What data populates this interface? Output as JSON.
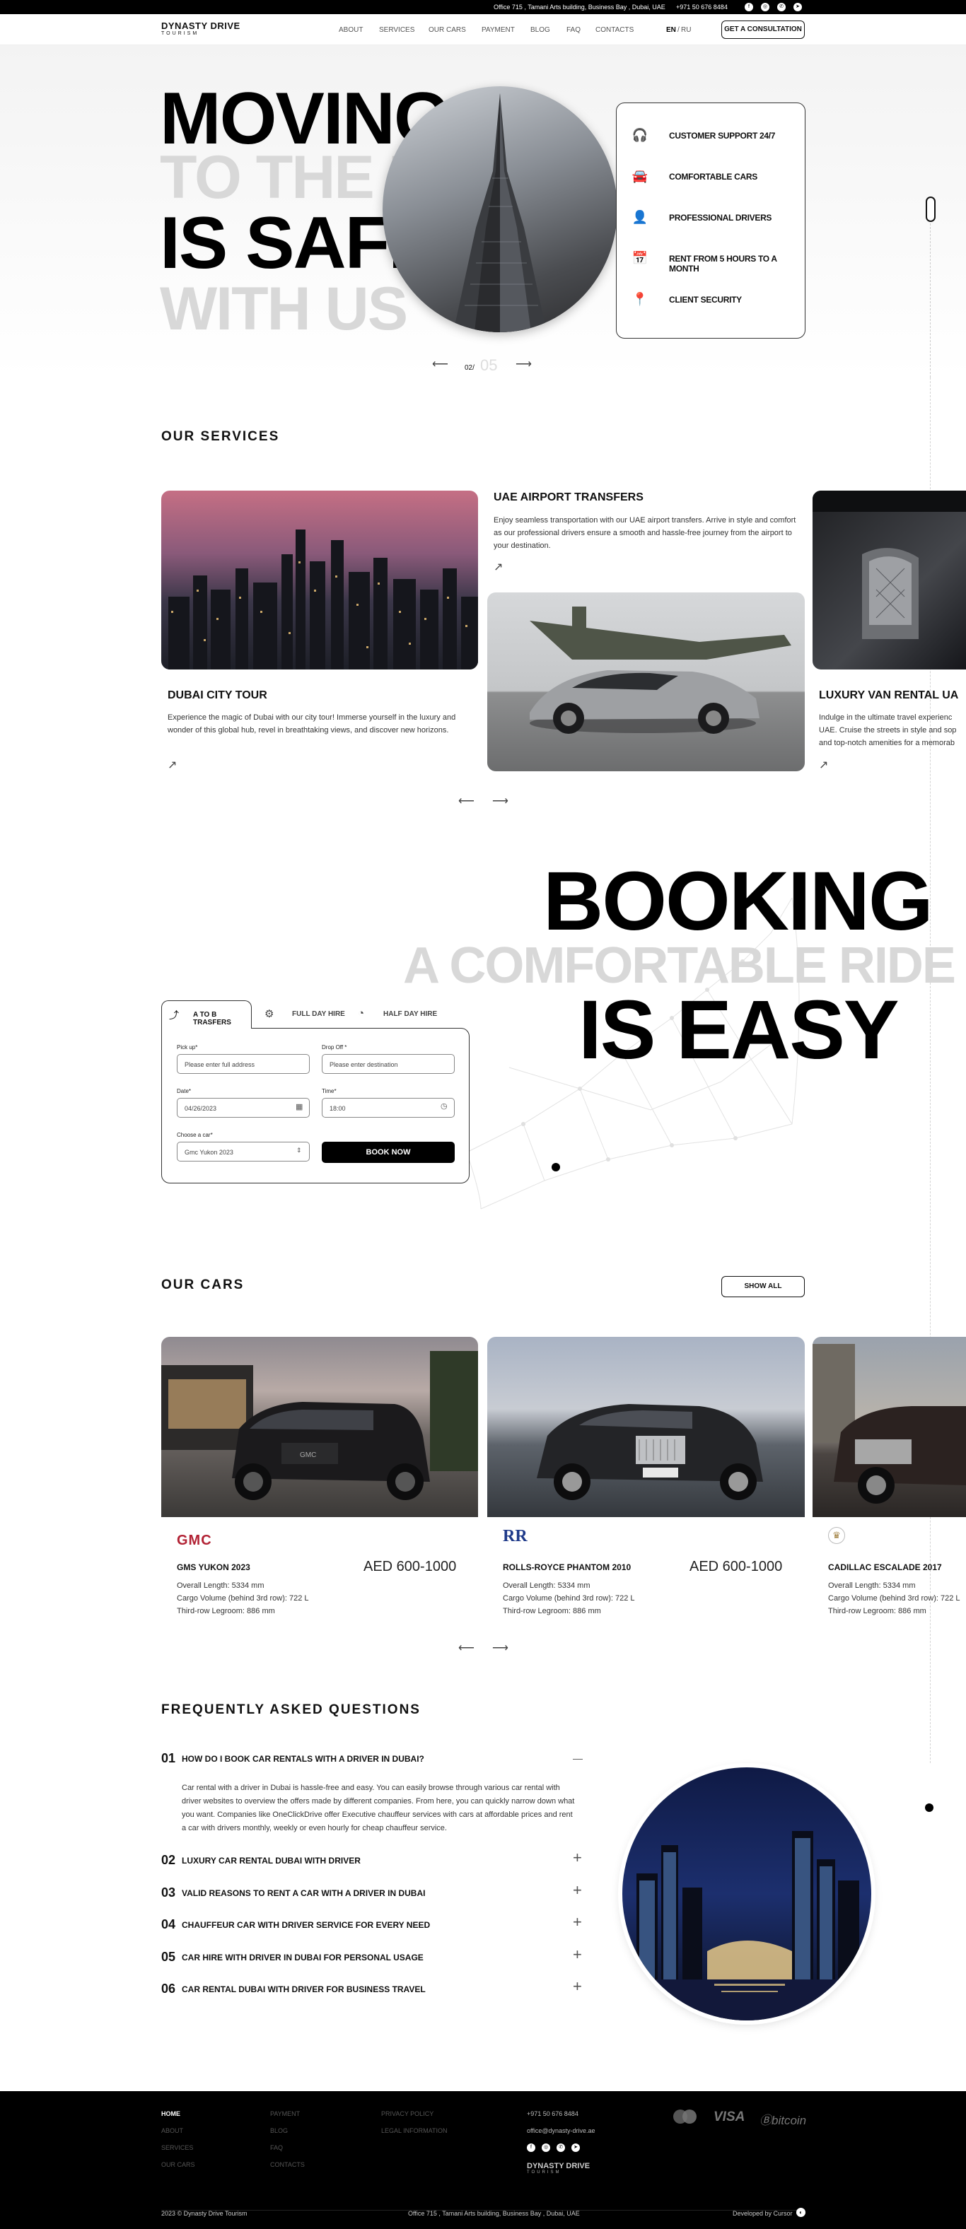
{
  "topbar": {
    "address": "Office 715 , Tamani Arts building, Business Bay , Dubai, UAE",
    "phone": "+971 50 676 8484",
    "social_icons": [
      "facebook-icon",
      "instagram-icon",
      "whatsapp-icon",
      "telegram-icon"
    ]
  },
  "nav": {
    "logo_title": "DYNASTY DRIVE",
    "logo_sub": "TOURISM",
    "links": [
      "ABOUT",
      "SERVICES",
      "OUR CARS",
      "PAYMENT",
      "BLOG",
      "FAQ",
      "CONTACTS"
    ],
    "lang_en": "EN",
    "lang_sep": "/",
    "lang_ru": "RU",
    "cta": "GET A CONSULTATION"
  },
  "hero": {
    "line1": "MOVING",
    "line2": "TO THE UAE",
    "line3": "IS SAFE",
    "line4": "WITH US",
    "features": [
      "CUSTOMER SUPPORT 24/7",
      "COMFORTABLE CARS",
      "PROFESSIONAL DRIVERS",
      "RENT FROM 5 HOURS TO A MONTH",
      "CLIENT SECURITY"
    ],
    "feature_icons": [
      "support-24-icon",
      "car-icon",
      "driver-icon",
      "calendar-icon",
      "security-pin-icon"
    ],
    "slide_current": "02/",
    "slide_total": "05",
    "prev": "⟵",
    "next": "⟶"
  },
  "services": {
    "title": "OUR SERVICES",
    "cards": [
      {
        "title": "DUBAI CITY TOUR",
        "text": "Experience the magic of Dubai with our city tour! Immerse yourself in the luxury and wonder of this global hub, revel in breathtaking views, and discover new horizons."
      },
      {
        "title": "UAE AIRPORT TRANSFERS",
        "text": "Enjoy seamless transportation with our UAE airport transfers. Arrive in style and comfort as our professional drivers ensure a smooth and hassle-free journey from the airport to your destination."
      },
      {
        "title": "LUXURY VAN RENTAL UA",
        "text": "Indulge in the ultimate travel experienc UAE. Cruise the streets in style and sop and top-notch amenities for a memorab"
      }
    ],
    "arrow": "↗",
    "prev": "⟵",
    "next": "⟶"
  },
  "booking": {
    "line1": "BOOKING",
    "line2": "A COMFORTABLE RIDE",
    "line3": "IS EASY",
    "tabs": [
      "A TO B TRASFERS",
      "FULL DAY HIRE",
      "HALF DAY HIRE"
    ],
    "pickup_label": "Pick up*",
    "pickup_placeholder": "Please enter full address",
    "dropoff_label": "Drop Off *",
    "dropoff_placeholder": "Please enter destination",
    "date_label": "Date*",
    "date_value": "04/26/2023",
    "time_label": "Time*",
    "time_value": "18:00",
    "car_label": "Choose a car*",
    "car_value": "Gmc Yukon 2023",
    "submit": "BOOK NOW"
  },
  "cars": {
    "title": "OUR CARS",
    "show_all": "SHOW ALL",
    "items": [
      {
        "brand": "GMC",
        "name": "GMS YUKON 2023",
        "price": "AED 600-1000",
        "specs": [
          "Overall Length: 5334 mm",
          "Cargo Volume (behind 3rd row): 722 L",
          "Third-row Legroom: 886 mm"
        ]
      },
      {
        "brand": "RR",
        "name": "ROLLS-ROYCE PHANTOM 2010",
        "price": "AED 600-1000",
        "specs": [
          "Overall Length: 5334 mm",
          "Cargo Volume (behind 3rd row): 722 L",
          "Third-row Legroom: 886 mm"
        ]
      },
      {
        "brand": "Cadillac",
        "name": "CADILLAC ESCALADE 2017",
        "price": "",
        "specs": [
          "Overall Length: 5334 mm",
          "Cargo Volume (behind 3rd row): 722 L",
          "Third-row Legroom: 886 mm"
        ]
      }
    ],
    "prev": "⟵",
    "next": "⟶"
  },
  "faq": {
    "title": "FREQUENTLY ASKED QUESTIONS",
    "items": [
      {
        "num": "01",
        "q": "HOW DO I BOOK CAR RENTALS WITH A DRIVER IN DUBAI?",
        "a": "Car rental with a driver in Dubai is hassle-free and easy. You can easily browse through various car rental with driver websites to overview the offers made by different companies. From here, you can quickly narrow down what you want. Companies like OneClickDrive offer Executive chauffeur services with cars at affordable prices and rent a car with drivers monthly, weekly or even hourly for cheap chauffeur service."
      },
      {
        "num": "02",
        "q": "LUXURY CAR RENTAL DUBAI WITH DRIVER"
      },
      {
        "num": "03",
        "q": "VALID REASONS TO RENT A CAR WITH A DRIVER IN DUBAI"
      },
      {
        "num": "04",
        "q": "CHAUFFEUR CAR WITH DRIVER SERVICE FOR EVERY NEED"
      },
      {
        "num": "05",
        "q": "CAR HIRE WITH DRIVER IN DUBAI FOR PERSONAL USAGE"
      },
      {
        "num": "06",
        "q": "CAR RENTAL DUBAI WITH DRIVER FOR BUSINESS TRAVEL"
      }
    ],
    "minus": "—",
    "plus": "+"
  },
  "footer": {
    "col1": [
      "HOME",
      "ABOUT",
      "SERVICES",
      "OUR CARS"
    ],
    "col2": [
      "PAYMENT",
      "BLOG",
      "FAQ",
      "CONTACTS"
    ],
    "col3": [
      "PRIVACY POLICY",
      "LEGAL INFORMATION"
    ],
    "phone": "+971 50 676 8484",
    "email": "office@dynasty-drive.ae",
    "logo_title": "DYNASTY DRIVE",
    "logo_sub": "TOURISM",
    "payments": [
      "mastercard",
      "VISA",
      "bitcoin"
    ],
    "copyright": "2023 © Dynasty Drive Tourism",
    "address": "Office 715 , Tamani Arts building, Business Bay , Dubai, UAE",
    "developer": "Developed by Cursor"
  }
}
